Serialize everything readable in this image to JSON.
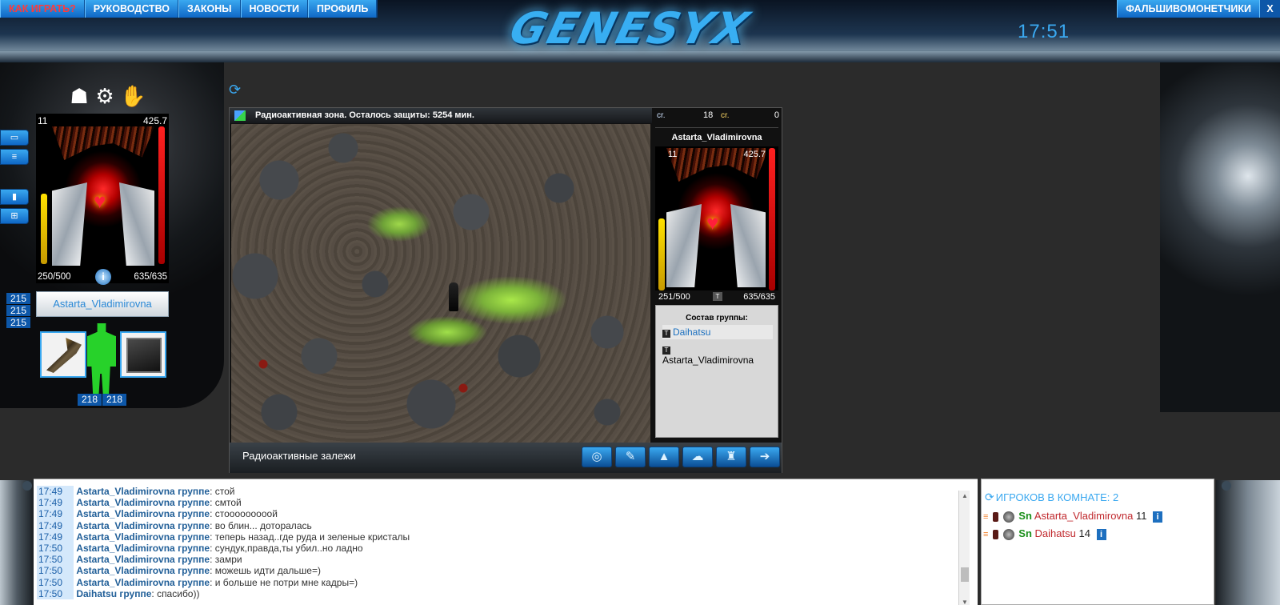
{
  "nav": {
    "items": [
      "КАК ИГРАТЬ?",
      "РУКОВОДСТВО",
      "ЗАКОНЫ",
      "НОВОСТИ",
      "ПРОФИЛЬ"
    ],
    "right_item": "ФАЛЬШИВОМОНЕТЧИКИ",
    "close": "X"
  },
  "logo": "GENESYX",
  "clock": "17:51",
  "player": {
    "level": "11",
    "experience": "425.7",
    "hp": "250/500",
    "mana": "635/635",
    "name": "Astarta_Vladimirovna",
    "stats": [
      "215",
      "215",
      "215"
    ],
    "stats_bottom": [
      "218",
      "218"
    ],
    "info_icon": "i"
  },
  "game": {
    "title": "Радиоактивная зона. Осталось защиты: 5254 мин.",
    "location": "Радиоактивные залежи",
    "currency1_label": "cr.",
    "currency1_value": "18",
    "currency2_label": "cr.",
    "currency2_value": "0",
    "action_icons": [
      "radar-icon",
      "map-pen-icon",
      "tower-icon",
      "cloud-icon",
      "robot-icon",
      "exit-icon"
    ]
  },
  "target": {
    "name": "Astarta_Vladimirovna",
    "level": "11",
    "experience": "425.7",
    "hp": "251/500",
    "mana": "635/635",
    "t": "T"
  },
  "group": {
    "title": "Состав группы:",
    "members": [
      "Daihatsu",
      "Astarta_Vladimirovna"
    ]
  },
  "chat": {
    "lines": [
      {
        "time": "17:49",
        "who": "Astarta_Vladimirovna",
        "to": "группе",
        "text": "стой"
      },
      {
        "time": "17:49",
        "who": "Astarta_Vladimirovna",
        "to": "группе",
        "text": "смтой"
      },
      {
        "time": "17:49",
        "who": "Astarta_Vladimirovna",
        "to": "группе",
        "text": "стооооооооой"
      },
      {
        "time": "17:49",
        "who": "Astarta_Vladimirovna",
        "to": "группе",
        "text": "во блин... доторалась"
      },
      {
        "time": "17:49",
        "who": "Astarta_Vladimirovna",
        "to": "группе",
        "text": "теперь назад..где руда и зеленые кристалы"
      },
      {
        "time": "17:50",
        "who": "Astarta_Vladimirovna",
        "to": "группе",
        "text": "сундук,правда,ты убил..но ладно"
      },
      {
        "time": "17:50",
        "who": "Astarta_Vladimirovna",
        "to": "группе",
        "text": "замри"
      },
      {
        "time": "17:50",
        "who": "Astarta_Vladimirovna",
        "to": "группе",
        "text": "можешь идти дальше=)"
      },
      {
        "time": "17:50",
        "who": "Astarta_Vladimirovna",
        "to": "группе",
        "text": "и больше не потри мне кадры=)"
      },
      {
        "time": "17:50",
        "who": "Daihatsu",
        "to": "группе",
        "text": "спасибо))"
      }
    ]
  },
  "room": {
    "header": "ИГРОКОВ В КОМНАТЕ: 2",
    "players": [
      {
        "tag": "Sn",
        "name": "Astarta_Vladimirovna",
        "level": "11"
      },
      {
        "tag": "Sn",
        "name": "Daihatsu",
        "level": "14"
      }
    ]
  }
}
